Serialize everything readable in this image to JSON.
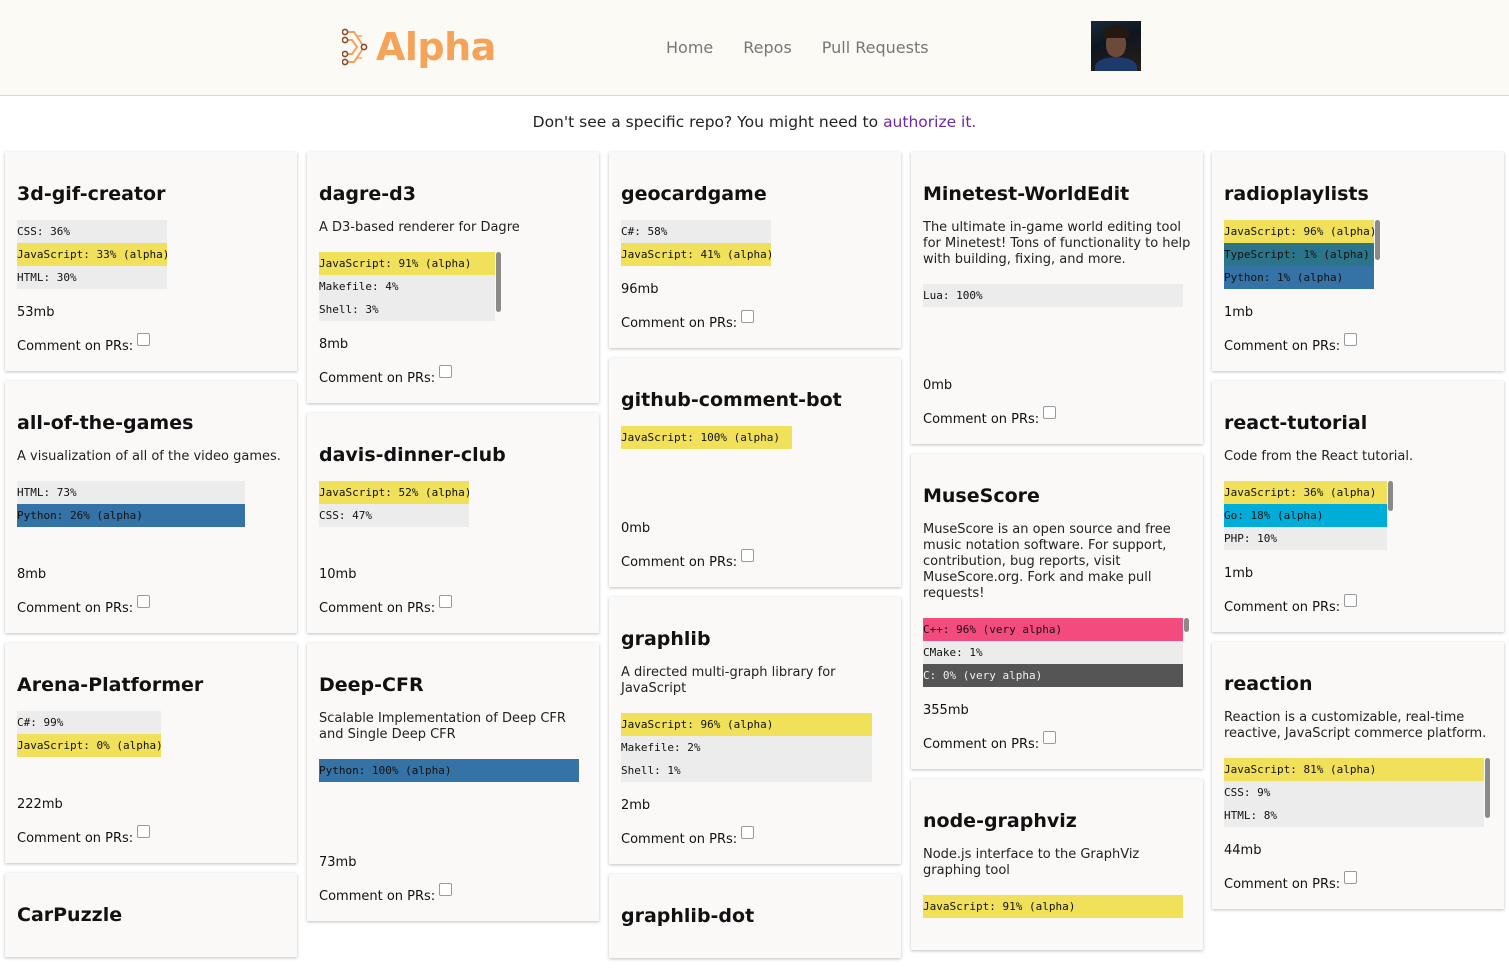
{
  "header": {
    "logo_text": "Alpha",
    "logo_icon": "circuit-arrow-icon",
    "nav": [
      "Home",
      "Repos",
      "Pull Requests"
    ],
    "avatar": "user-avatar"
  },
  "notice": {
    "text": "Don't see a specific repo? You might need to ",
    "link": "authorize it."
  },
  "comment_label": "Comment on PRs:",
  "columns": [
    [
      {
        "name": "3d-gif-creator",
        "desc": "",
        "langs": [
          {
            "label": "CSS: 36%",
            "color": "#ececec"
          },
          {
            "label": "JavaScript: 33% (alpha)",
            "color": "#f1e05a"
          },
          {
            "label": "HTML: 30%",
            "color": "#ececec"
          }
        ],
        "lang_width": 150,
        "size": "53mb"
      },
      {
        "name": "all-of-the-games",
        "desc": "A visualization of all of the video games.",
        "langs": [
          {
            "label": "HTML: 73%",
            "color": "#ececec"
          },
          {
            "label": "Python: 26% (alpha)",
            "color": "#3572a5"
          }
        ],
        "lang_width": 228,
        "size": "8mb"
      },
      {
        "name": "Arena-Platformer",
        "desc": "",
        "langs": [
          {
            "label": "C#: 99%",
            "color": "#ececec"
          },
          {
            "label": "JavaScript: 0% (alpha)",
            "color": "#f1e05a"
          }
        ],
        "lang_width": 144,
        "size": "222mb"
      },
      {
        "name": "CarPuzzle",
        "desc": "",
        "langs": [],
        "lang_width": 0,
        "size": ""
      }
    ],
    [
      {
        "name": "dagre-d3",
        "desc": "A D3-based renderer for Dagre",
        "langs": [
          {
            "label": "JavaScript: 91% (alpha)",
            "color": "#f1e05a"
          },
          {
            "label": "Makefile: 4%",
            "color": "#ececec"
          },
          {
            "label": "Shell: 3%",
            "color": "#ececec"
          }
        ],
        "lang_width": 176,
        "scroll": true,
        "size": "8mb"
      },
      {
        "name": "davis-dinner-club",
        "desc": "",
        "langs": [
          {
            "label": "JavaScript: 52% (alpha)",
            "color": "#f1e05a"
          },
          {
            "label": "CSS: 47%",
            "color": "#ececec"
          }
        ],
        "lang_width": 150,
        "size": "10mb"
      },
      {
        "name": "Deep-CFR",
        "desc": "Scalable Implementation of Deep CFR and Single Deep CFR",
        "langs": [
          {
            "label": "Python: 100% (alpha)",
            "color": "#3572a5"
          }
        ],
        "lang_width": 260,
        "size": "73mb"
      }
    ],
    [
      {
        "name": "geocardgame",
        "desc": "",
        "langs": [
          {
            "label": "C#: 58%",
            "color": "#ececec"
          },
          {
            "label": "JavaScript: 41% (alpha)",
            "color": "#f1e05a"
          }
        ],
        "lang_width": 150,
        "size": "96mb"
      },
      {
        "name": "github-comment-bot",
        "desc": "",
        "langs": [
          {
            "label": "JavaScript: 100% (alpha)",
            "color": "#f1e05a"
          }
        ],
        "lang_width": 171,
        "size": "0mb"
      },
      {
        "name": "graphlib",
        "desc": "A directed multi-graph library for JavaScript",
        "langs": [
          {
            "label": "JavaScript: 96% (alpha)",
            "color": "#f1e05a"
          },
          {
            "label": "Makefile: 2%",
            "color": "#ececec"
          },
          {
            "label": "Shell: 1%",
            "color": "#ececec"
          }
        ],
        "lang_width": 251,
        "size": "2mb"
      },
      {
        "name": "graphlib-dot",
        "desc": "",
        "langs": [],
        "lang_width": 0,
        "size": ""
      }
    ],
    [
      {
        "name": "Minetest-WorldEdit",
        "desc": "The ultimate in-game world editing tool for Minetest! Tons of functionality to help with building, fixing, and more.",
        "langs": [
          {
            "label": "Lua: 100%",
            "color": "#ececec"
          }
        ],
        "lang_width": 260,
        "size": "0mb"
      },
      {
        "name": "MuseScore",
        "desc": "MuseScore is an open source and free music notation software. For support, contribution, bug reports, visit MuseScore.org. Fork and make pull requests!",
        "langs": [
          {
            "label": "C++: 96% (very alpha)",
            "color": "#f34b7d"
          },
          {
            "label": "CMake: 1%",
            "color": "#ececec"
          },
          {
            "label": "C: 0% (very alpha)",
            "color": "#555555"
          }
        ],
        "lang_width": 260,
        "scroll": true,
        "size": "355mb"
      },
      {
        "name": "node-graphviz",
        "desc": "Node.js interface to the GraphViz graphing tool",
        "langs": [
          {
            "label": "JavaScript: 91% (alpha)",
            "color": "#f1e05a"
          }
        ],
        "lang_width": 260,
        "size": ""
      }
    ],
    [
      {
        "name": "radioplaylists",
        "desc": "",
        "langs": [
          {
            "label": "JavaScript: 96% (alpha)",
            "color": "#f1e05a"
          },
          {
            "label": "TypeScript: 1% (alpha)",
            "color": "#2b7489"
          },
          {
            "label": "Python: 1% (alpha)",
            "color": "#3572a5"
          }
        ],
        "lang_width": 150,
        "scroll": true,
        "size": "1mb"
      },
      {
        "name": "react-tutorial",
        "desc": "Code from the React tutorial.",
        "langs": [
          {
            "label": "JavaScript: 36% (alpha)",
            "color": "#f1e05a"
          },
          {
            "label": "Go: 18% (alpha)",
            "color": "#00add8"
          },
          {
            "label": "PHP: 10%",
            "color": "#ececec"
          }
        ],
        "lang_width": 163,
        "scroll": true,
        "size": "1mb"
      },
      {
        "name": "reaction",
        "desc": "Reaction is a customizable, real-time reactive, JavaScript commerce platform.",
        "langs": [
          {
            "label": "JavaScript: 81% (alpha)",
            "color": "#f1e05a"
          },
          {
            "label": "CSS: 9%",
            "color": "#ececec"
          },
          {
            "label": "HTML: 8%",
            "color": "#ececec"
          }
        ],
        "lang_width": 260,
        "scroll": true,
        "size": "44mb"
      }
    ]
  ]
}
